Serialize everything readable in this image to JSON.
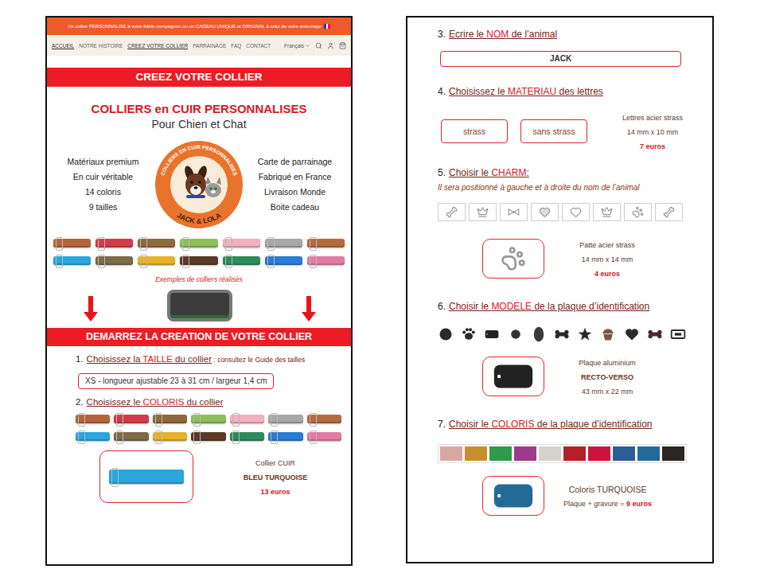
{
  "announcement": "Un collier PERSONNALISE à votre fidèle compagnon ou un CADEAU UNIQUE et ORIGINAL à celui de votre entourage",
  "nav": {
    "items": [
      {
        "label": "ACCUEIL",
        "selected": true
      },
      {
        "label": "NOTRE HISTOIRE",
        "selected": false
      },
      {
        "label": "CREEZ VOTRE COLLIER",
        "selected": true
      },
      {
        "label": "PARRAINAGE",
        "selected": false
      },
      {
        "label": "FAQ",
        "selected": false
      },
      {
        "label": "CONTACT",
        "selected": false
      }
    ],
    "language": "Français"
  },
  "page_banner": "CREEZ VOTRE COLLIER",
  "hero": {
    "title": "COLLIERS en CUIR PERSONNALISES",
    "subtitle": "Pour Chien et Chat",
    "features_left": [
      "Matériaux premium",
      "En cuir véritable",
      "14 coloris",
      "9 tailles"
    ],
    "features_right": [
      "Carte de parrainage",
      "Fabriqué en France",
      "Livraison Monde",
      "Boite cadeau"
    ],
    "logo": {
      "ring": "COLLIERS EN CUIR PERSONNALISES",
      "name": "JACK & LOLA"
    }
  },
  "examples": {
    "collars": [
      {
        "color": "#b8643a"
      },
      {
        "color": "#d23c48"
      },
      {
        "color": "#8c6b3c"
      },
      {
        "color": "#8fbf5c"
      },
      {
        "color": "#f2b0c0"
      },
      {
        "color": "#a8a8a8"
      },
      {
        "color": "#b66a40"
      },
      {
        "color": "#2aa6dc"
      },
      {
        "color": "#7c6c48"
      },
      {
        "color": "#e6b22c"
      },
      {
        "color": "#5c3a26"
      },
      {
        "color": "#2e8c5c"
      },
      {
        "color": "#2c7cd2"
      },
      {
        "color": "#e27ca4"
      }
    ],
    "caption": "Exemples de colliers réalisés"
  },
  "start_banner": "DEMARREZ LA CREATION DE VOTRE COLLIER",
  "step1": {
    "number": "1.",
    "before": "Choisissez la ",
    "keyword": "TAILLE",
    "after": " du collier",
    "note": " : consultez le Guide des tailles",
    "value": "XS - longueur ajustable 23 à 31 cm / largeur 1,4 cm"
  },
  "step2": {
    "number": "2.",
    "before": "Choisissez le ",
    "keyword": "COLORIS",
    "after": " du collier",
    "collars": [
      {
        "color": "#b8643a",
        "selected": false
      },
      {
        "color": "#d23c48",
        "selected": false
      },
      {
        "color": "#8c6b3c",
        "selected": false
      },
      {
        "color": "#8fbf5c",
        "selected": false
      },
      {
        "color": "#f2b0c0",
        "selected": false
      },
      {
        "color": "#a8a8a8",
        "selected": false
      },
      {
        "color": "#b66a40",
        "selected": false
      },
      {
        "color": "#2aa6dc",
        "selected": true
      },
      {
        "color": "#7c6c48",
        "selected": false
      },
      {
        "color": "#e6b22c",
        "selected": false
      },
      {
        "color": "#5c3a26",
        "selected": false
      },
      {
        "color": "#2e8c5c",
        "selected": false
      },
      {
        "color": "#2c7cd2",
        "selected": false
      },
      {
        "color": "#e27ca4",
        "selected": false
      }
    ],
    "info": [
      [
        {
          "text": "Collier CUIR",
          "kind": "text"
        }
      ],
      [
        {
          "text": "BLEU TURQUOISE",
          "kind": "bold"
        }
      ],
      [
        {
          "text": "13 euros",
          "kind": "price"
        }
      ]
    ]
  },
  "step3": {
    "number": "3.",
    "before": "Ecrire le ",
    "keyword": "NOM",
    "after": " de l’animal",
    "value": "JACK"
  },
  "step4": {
    "number": "4.",
    "before": "Choisissez le ",
    "keyword": "MATERIAU",
    "after": " des lettres",
    "options": [
      "strass",
      "sans strass"
    ],
    "info": [
      [
        {
          "text": "Lettres acier strass",
          "kind": "text"
        }
      ],
      [
        {
          "text": "14 mm x 10 mm",
          "kind": "text"
        }
      ],
      [
        {
          "text": "7 euros",
          "kind": "price"
        }
      ]
    ]
  },
  "step5": {
    "number": "5.",
    "before": "Choisir le ",
    "keyword": "CHARM",
    "after": ":",
    "hint": "Il sera positionné à gauche et à droite du nom de l’animal",
    "charms": [
      {
        "kind": "bone",
        "selected": false
      },
      {
        "kind": "crown",
        "selected": false
      },
      {
        "kind": "bow",
        "selected": false
      },
      {
        "kind": "paw-heart",
        "selected": false
      },
      {
        "kind": "heart",
        "selected": false
      },
      {
        "kind": "crown",
        "selected": false
      },
      {
        "kind": "paw",
        "selected": true
      },
      {
        "kind": "bone",
        "selected": false
      }
    ],
    "info": [
      [
        {
          "text": "Patte acier strass",
          "kind": "text"
        }
      ],
      [
        {
          "text": "14 mm x 14 mm",
          "kind": "text"
        }
      ],
      [
        {
          "text": "4 euros",
          "kind": "price"
        }
      ]
    ]
  },
  "step6": {
    "number": "6.",
    "before": "Choisir le ",
    "keyword": "MODELE",
    "after": " de la plaque d’identification",
    "shapes": [
      {
        "kind": "circle",
        "color": "#2a2a2a",
        "selected": false
      },
      {
        "kind": "paw",
        "color": "#2a2a2a",
        "selected": false
      },
      {
        "kind": "rect",
        "color": "#222222",
        "selected": true
      },
      {
        "kind": "small-circle",
        "color": "#333333",
        "selected": false
      },
      {
        "kind": "oval",
        "color": "#3a3a3a",
        "selected": false
      },
      {
        "kind": "bone",
        "color": "#2a2a2a",
        "selected": false
      },
      {
        "kind": "star",
        "color": "#2a2a2a",
        "selected": false
      },
      {
        "kind": "cupcake",
        "color": "#7a5a44",
        "selected": false
      },
      {
        "kind": "heart",
        "color": "#2a2a2a",
        "selected": false
      },
      {
        "kind": "bone",
        "color": "#4a2a2a",
        "selected": false
      },
      {
        "kind": "tag",
        "color": "#2a2a2a",
        "selected": false
      }
    ],
    "info": [
      [
        {
          "text": "Plaque aluminium",
          "kind": "text"
        }
      ],
      [
        {
          "text": "RECTO-VERSO",
          "kind": "bold"
        }
      ],
      [
        {
          "text": "43 mm x 22 mm",
          "kind": "text"
        }
      ]
    ]
  },
  "step7": {
    "number": "7.",
    "before": "Choisir le ",
    "keyword": "COLORIS",
    "after": " de la plaque d’identification",
    "swatches": [
      {
        "color": "#d8a8a0",
        "selected": false
      },
      {
        "color": "#c8902c",
        "selected": false
      },
      {
        "color": "#2f9a48",
        "selected": false
      },
      {
        "color": "#9c3a8c",
        "selected": false
      },
      {
        "color": "#d4d2ca",
        "selected": false
      },
      {
        "color": "#b42028",
        "selected": false
      },
      {
        "color": "#cc143e",
        "selected": false
      },
      {
        "color": "#2a5e92",
        "selected": false
      },
      {
        "color": "#236a96",
        "selected": true
      },
      {
        "color": "#2a2623",
        "selected": false
      }
    ],
    "info": [
      [
        {
          "text": "Coloris TURQUOISE",
          "kind": "large"
        }
      ],
      [
        {
          "text": "Plaque + gravure = ",
          "kind": "text"
        },
        {
          "text": "9 euros",
          "kind": "price"
        }
      ]
    ]
  }
}
